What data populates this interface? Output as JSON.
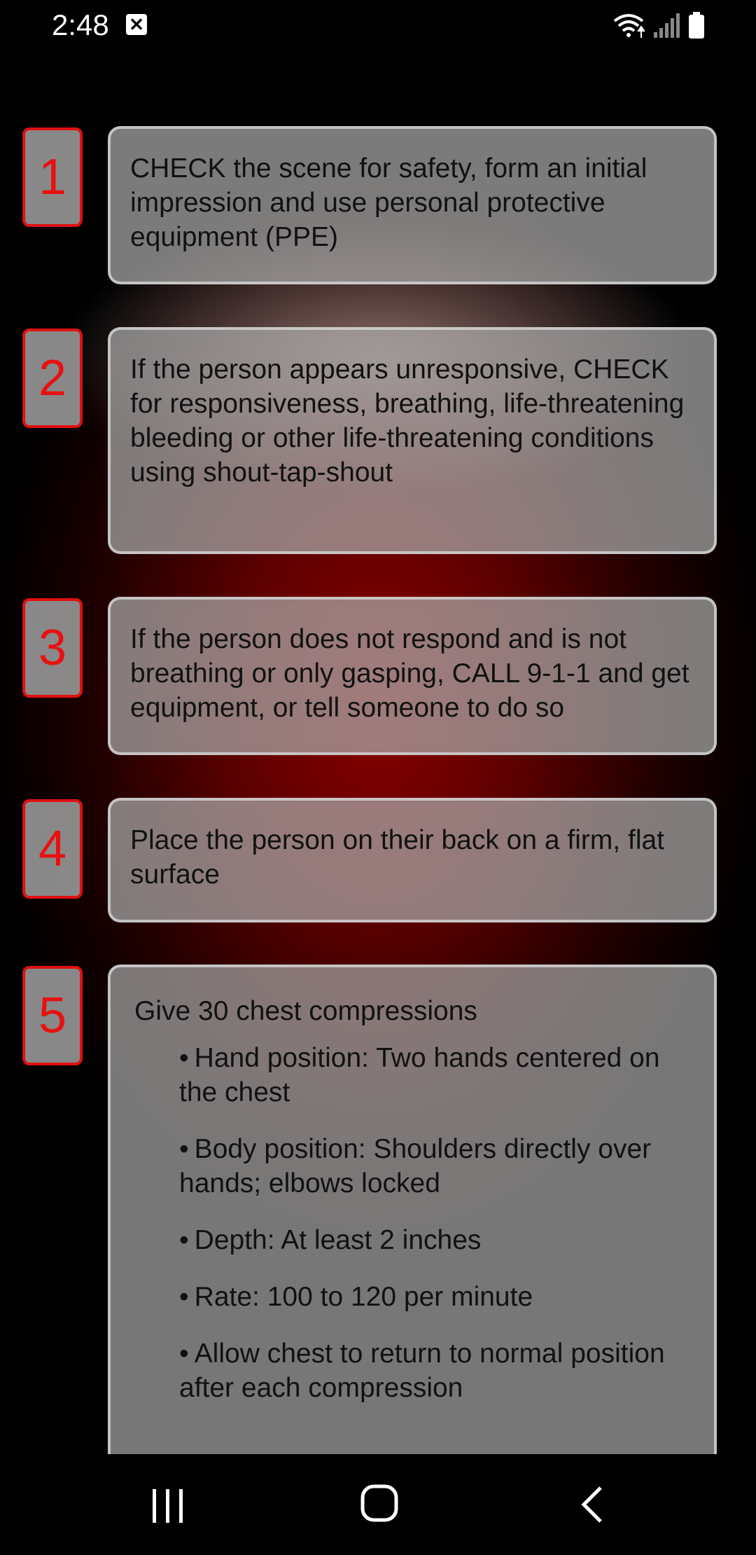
{
  "status_bar": {
    "time": "2:48"
  },
  "steps": [
    {
      "number": "1",
      "text": "CHECK the scene for safety, form an initial impression and use personal protective equipment (PPE)"
    },
    {
      "number": "2",
      "text": "If the person appears unresponsive, CHECK for responsiveness, breathing, life-threatening bleeding or other life-threatening conditions using shout-tap-shout"
    },
    {
      "number": "3",
      "text": "If the person does not respond and is not breathing or only gasping, CALL 9-1-1 and get equipment, or tell someone to do so"
    },
    {
      "number": "4",
      "text": "Place the person on their back on a firm, flat surface"
    },
    {
      "number": "5",
      "title": "Give 30 chest compressions",
      "bullets": [
        "Hand position: Two hands centered on the chest",
        "Body position: Shoulders directly over hands; elbows locked",
        "Depth: At least 2 inches",
        "Rate: 100 to 120 per minute",
        "Allow chest to return to normal position after each compression"
      ]
    }
  ],
  "colors": {
    "number_red": "#e81010",
    "background_red": "#8a0000"
  },
  "nav_bar": {
    "icons": [
      "recent-apps-icon",
      "home-icon",
      "back-icon"
    ]
  }
}
